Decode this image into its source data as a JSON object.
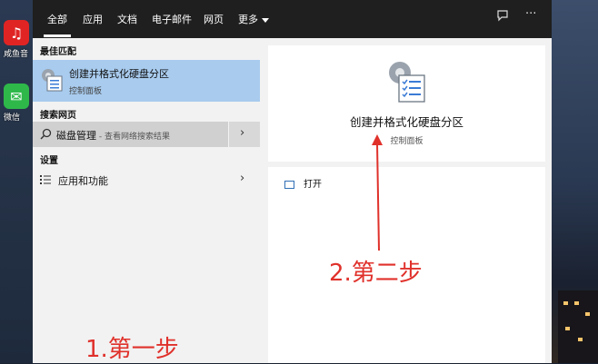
{
  "desktop": {
    "icons": [
      {
        "name": "netease-music",
        "label": "咸鱼音",
        "color": "#e02424",
        "glyph": "♫"
      },
      {
        "name": "wechat",
        "label": "微信",
        "color": "#2fb84a",
        "glyph": "✉"
      }
    ]
  },
  "topbar": {
    "tabs": [
      "全部",
      "应用",
      "文档",
      "电子邮件",
      "网页",
      "更多"
    ],
    "active_tab": "全部",
    "feedback_icon": "feedback-icon",
    "more_options_icon": "ellipsis-icon"
  },
  "results": {
    "best_match_header": "最佳匹配",
    "best_match": {
      "title": "创建并格式化硬盘分区",
      "subtitle": "控制面板",
      "icon": "control-panel-icon"
    },
    "web_header": "搜索网页",
    "web_query": "磁盘管理",
    "web_hint": " - 查看网络搜索结果",
    "settings_header": "设置",
    "settings_item": "应用和功能"
  },
  "preview": {
    "title": "创建并格式化硬盘分区",
    "subtitle": "控制面板",
    "open_label": "打开"
  },
  "annotations": {
    "step1": "1.第一步",
    "step2": "2.第二步"
  },
  "colors": {
    "highlight": "#a8cbee",
    "topbar": "#1f1f1f",
    "annotation_red": "#e0312b"
  }
}
